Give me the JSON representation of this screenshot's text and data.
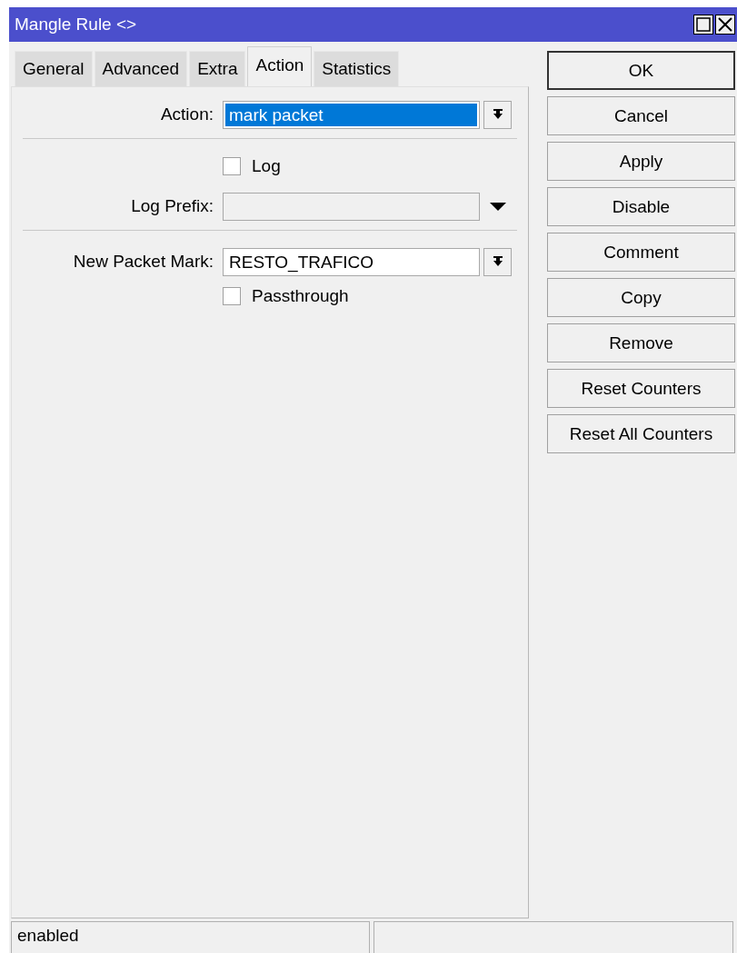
{
  "window": {
    "title": "Mangle Rule <>"
  },
  "tabs": [
    {
      "label": "General",
      "selected": false
    },
    {
      "label": "Advanced",
      "selected": false
    },
    {
      "label": "Extra",
      "selected": false
    },
    {
      "label": "Action",
      "selected": true
    },
    {
      "label": "Statistics",
      "selected": false
    }
  ],
  "form": [
    {
      "kind": "select",
      "label": "Action:",
      "value": "mark packet",
      "highlighted": true
    },
    {
      "kind": "divider"
    },
    {
      "kind": "checkbox",
      "label": "Log",
      "checked": false
    },
    {
      "kind": "combo",
      "label": "Log Prefix:",
      "disabled": true
    },
    {
      "kind": "divider"
    },
    {
      "kind": "select",
      "label": "New Packet Mark:",
      "value": "RESTO_TRAFICO",
      "highlighted": false
    },
    {
      "kind": "checkbox",
      "label": "Passthrough",
      "checked": false
    }
  ],
  "buttons": [
    {
      "label": "OK",
      "default": true
    },
    {
      "label": "Cancel",
      "default": false
    },
    {
      "label": "Apply",
      "default": false
    },
    {
      "label": "Disable",
      "default": false
    },
    {
      "label": "Comment",
      "default": false
    },
    {
      "label": "Copy",
      "default": false
    },
    {
      "label": "Remove",
      "default": false
    },
    {
      "label": "Reset Counters",
      "default": false
    },
    {
      "label": "Reset All Counters",
      "default": false
    }
  ],
  "status_bar": {
    "text": "enabled"
  }
}
